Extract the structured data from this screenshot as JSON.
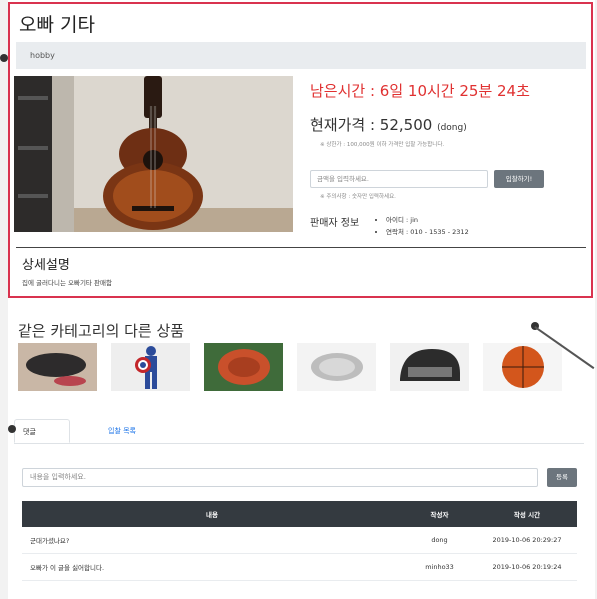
{
  "product": {
    "title": "오빠 기타",
    "category": "hobby",
    "time_left": "남은시간 : 6일 10시간 25분 24초",
    "price_label": "현재가격 : 52,500",
    "price_unit": "(dong)",
    "price_note": "※ 상한가 : 100,000원 이하 가격만 입찰 가능합니다.",
    "bid_placeholder": "금액을 입력하세요.",
    "bid_button": "입찰하기!",
    "bid_note": "※ 주의사항 : 숫자만 입력하세요.",
    "seller_label": "판매자 정보",
    "seller_id": "아이디 : jin",
    "seller_contact": "연락처 : 010 - 1535 - 2312",
    "detail_heading": "상세설명",
    "detail_text": "집에 굴러다니는 오빠기타 판매함"
  },
  "related": {
    "heading": "같은 카테고리의 다른 상품",
    "items": [
      {
        "icon": "bag-thumbnail"
      },
      {
        "icon": "captain-america-figure-thumbnail"
      },
      {
        "icon": "baseball-glove-thumbnail"
      },
      {
        "icon": "paper-clips-thumbnail"
      },
      {
        "icon": "helmet-thumbnail"
      },
      {
        "icon": "basketball-thumbnail"
      }
    ]
  },
  "tabs": {
    "comments": "댓글",
    "bids": "입찰 목록"
  },
  "comments": {
    "placeholder": "내용을 입력하세요.",
    "submit": "등록",
    "headers": {
      "content": "내용",
      "author": "작성자",
      "time": "작성 시간"
    },
    "rows": [
      {
        "content": "군대가셨나요?",
        "author": "dong",
        "time": "2019-10-06 20:29:27"
      },
      {
        "content": "오빠가 이 글을 싫어합니다.",
        "author": "minho33",
        "time": "2019-10-06 20:19:24"
      }
    ]
  },
  "colors": {
    "card_border": "#d9334f",
    "time_left": "#e03131",
    "table_header": "#343a40",
    "button": "#6c757d",
    "link": "#1a73e8"
  }
}
